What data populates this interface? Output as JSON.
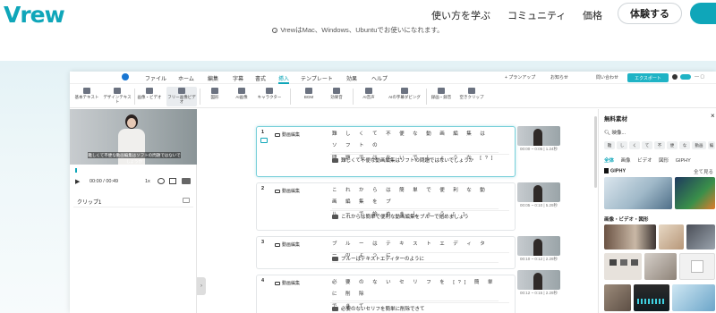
{
  "site": {
    "logo": "Vrew",
    "nav": [
      "使い方を学ぶ",
      "コミュニティ",
      "価格"
    ],
    "experience_button": "体験する",
    "notice": "VrewはMac、Windows、Ubuntuでお使いになれます。",
    "accent": "#0fa6b9"
  },
  "app": {
    "menu": [
      "ファイル",
      "ホーム",
      "編集",
      "字幕",
      "書式",
      "挿入",
      "テンプレート",
      "効果",
      "ヘルプ"
    ],
    "active_menu": "挿入",
    "plan_label": "+ プランアップ",
    "notice_label": "お知らせ",
    "contact_label": "問い合わせ",
    "export_label": "エクスポート",
    "tools": [
      "基本テキスト",
      "デザインテキスト",
      "画像・ビデオ",
      "フリー画像ビデオ",
      "図形",
      "AI画像",
      "キャラクター",
      "BGM",
      "効果音",
      "AI音声",
      "AIの字幕ダビング",
      "録画・録音",
      "空きクリップ"
    ],
    "video": {
      "caption": "難しくて不便な動画編集はソフトの問題ではないでしょうか",
      "time": "00:00 / 00:49",
      "speed": "1x"
    },
    "clip_label": "クリップ1",
    "rows": [
      {
        "num": "1",
        "speaker": "動画編集",
        "words": [
          "難 し く て 不 便 な 動 画 編 集 は ソ フ ト の",
          "問 題 で は な い で し ょ う か [?]"
        ],
        "subtitle": "難しくて不便な動画編集はソフトの問題ではないでしょうか",
        "time": "00:00 ~ 0:05 | 1.24秒"
      },
      {
        "num": "2",
        "speaker": "動画編集",
        "words": [
          "こ れ か ら は 簡 単 で 便 利 な 動 画 編 集 を プ",
          "ル ー で 始 め ま し ょ う [.]"
        ],
        "subtitle": "これからは簡単で便利な動画編集をブルーで始めましょう",
        "time": "00:05 ~ 0:10 | 5.29秒"
      },
      {
        "num": "3",
        "speaker": "動画編集",
        "words": [
          "ブ ル ー は テ キ ス ト エ デ ィ タ ー の よ う に"
        ],
        "subtitle": "ブルーはテキストエディターのように",
        "time": "00:10 ~ 0:12 | 2.29秒"
      },
      {
        "num": "4",
        "speaker": "動画編集",
        "words": [
          "必 要 の な い セ リ フ を [?] 簡 単 に 削 除",
          "で き て"
        ],
        "subtitle": "必要のないセリフを簡単に削除できて",
        "time": "00:12 ~ 0:15 | 2.29秒"
      }
    ],
    "panel": {
      "title": "無料素材",
      "search": "映像...",
      "chips": [
        "難",
        "し",
        "く",
        "て",
        "不",
        "便",
        "な",
        "動画",
        "編"
      ],
      "tabs": [
        "全体",
        "画像",
        "ビデオ",
        "図形",
        "GIPHY"
      ],
      "giphy_label": "GIPHY",
      "see_all": "全て見る",
      "section": "画像・ビデオ・図形"
    }
  }
}
